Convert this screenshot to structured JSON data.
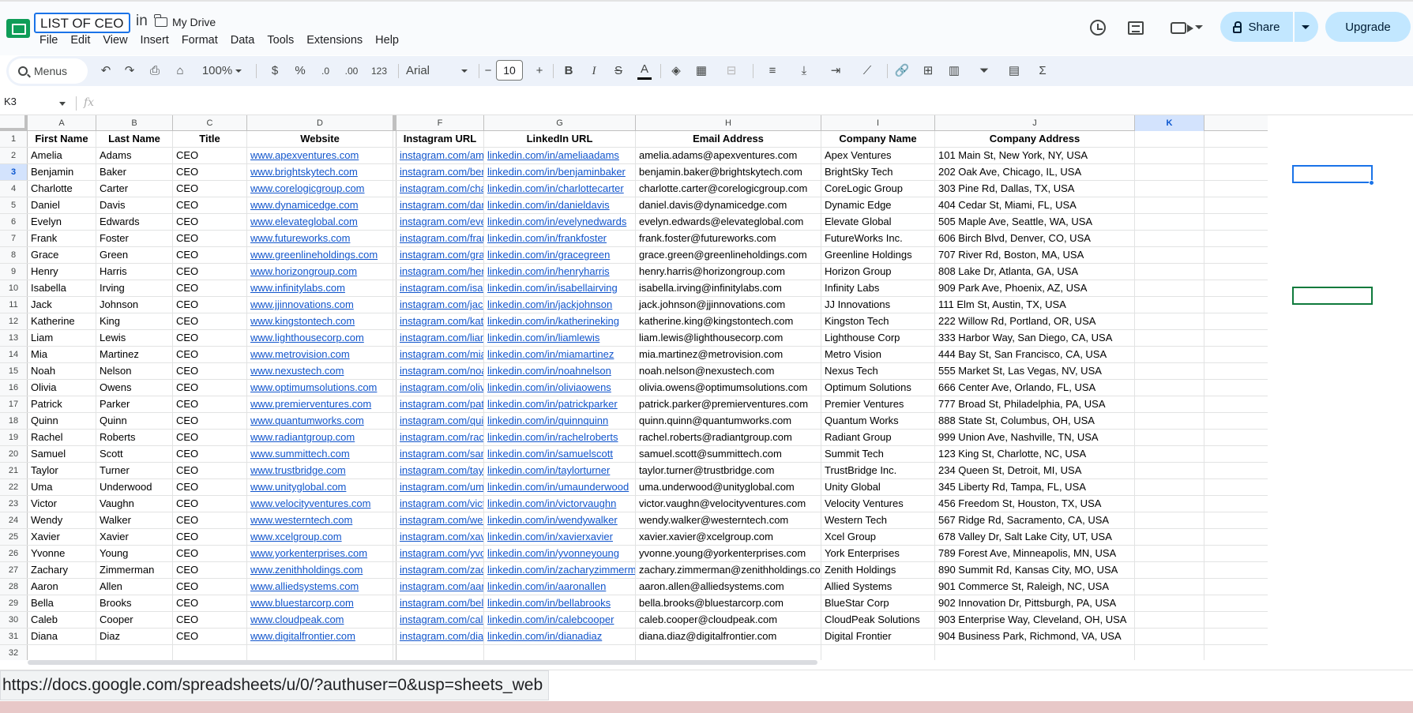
{
  "doc": {
    "title": "LIST OF CEO",
    "in_label": "in",
    "drive_label": "My Drive"
  },
  "menu": [
    "File",
    "Edit",
    "View",
    "Insert",
    "Format",
    "Data",
    "Tools",
    "Extensions",
    "Help"
  ],
  "actions": {
    "share_label": "Share",
    "upgrade_label": "Upgrade"
  },
  "toolbar": {
    "menus_label": "Menus",
    "zoom": "100%",
    "currency": "$",
    "percent": "%",
    "dec_decrease": ".0",
    "dec_increase": ".00",
    "number_format": "123",
    "font": "Arial",
    "font_size": "10",
    "minus": "−",
    "plus": "+",
    "bold": "B",
    "italic": "I",
    "strike": "S",
    "text_color": "A",
    "sigma": "Σ"
  },
  "formula_bar": {
    "cell_ref": "K3",
    "fx": "fx"
  },
  "grid": {
    "columns": [
      "A",
      "B",
      "C",
      "D",
      "F",
      "G",
      "H",
      "I",
      "J",
      "K"
    ],
    "selected_column": "K",
    "selected_row": 3,
    "header_row": [
      "First Name",
      "Last Name",
      "Title",
      "Website",
      "Instagram URL",
      "LinkedIn URL",
      "Email Address",
      "Company Name",
      "Company Address",
      ""
    ],
    "rows": [
      [
        "Amelia",
        "Adams",
        "CEO",
        "www.apexventures.com",
        "instagram.com/ameliaadams",
        "linkedin.com/in/ameliaadams",
        "amelia.adams@apexventures.com",
        "Apex Ventures",
        "101 Main St, New York, NY, USA",
        ""
      ],
      [
        "Benjamin",
        "Baker",
        "CEO",
        "www.brightskytech.com",
        "instagram.com/benjaminbaker",
        "linkedin.com/in/benjaminbaker",
        "benjamin.baker@brightskytech.com",
        "BrightSky Tech",
        "202 Oak Ave, Chicago, IL, USA",
        ""
      ],
      [
        "Charlotte",
        "Carter",
        "CEO",
        "www.corelogicgroup.com",
        "instagram.com/charlottecarter",
        "linkedin.com/in/charlottecarter",
        "charlotte.carter@corelogicgroup.com",
        "CoreLogic Group",
        "303 Pine Rd, Dallas, TX, USA",
        ""
      ],
      [
        "Daniel",
        "Davis",
        "CEO",
        "www.dynamicedge.com",
        "instagram.com/danieldavis",
        "linkedin.com/in/danieldavis",
        "daniel.davis@dynamicedge.com",
        "Dynamic Edge",
        "404 Cedar St, Miami, FL, USA",
        ""
      ],
      [
        "Evelyn",
        "Edwards",
        "CEO",
        "www.elevateglobal.com",
        "instagram.com/evelynedwards",
        "linkedin.com/in/evelynedwards",
        "evelyn.edwards@elevateglobal.com",
        "Elevate Global",
        "505 Maple Ave, Seattle, WA, USA",
        ""
      ],
      [
        "Frank",
        "Foster",
        "CEO",
        "www.futureworks.com",
        "instagram.com/frankfoster",
        "linkedin.com/in/frankfoster",
        "frank.foster@futureworks.com",
        "FutureWorks Inc.",
        "606 Birch Blvd, Denver, CO, USA",
        ""
      ],
      [
        "Grace",
        "Green",
        "CEO",
        "www.greenlineholdings.com",
        "instagram.com/gracegreen",
        "linkedin.com/in/gracegreen",
        "grace.green@greenlineholdings.com",
        "Greenline Holdings",
        "707 River Rd, Boston, MA, USA",
        ""
      ],
      [
        "Henry",
        "Harris",
        "CEO",
        "www.horizongroup.com",
        "instagram.com/henryharris",
        "linkedin.com/in/henryharris",
        "henry.harris@horizongroup.com",
        "Horizon Group",
        "808 Lake Dr, Atlanta, GA, USA",
        ""
      ],
      [
        "Isabella",
        "Irving",
        "CEO",
        "www.infinitylabs.com",
        "instagram.com/isabellairving",
        "linkedin.com/in/isabellairving",
        "isabella.irving@infinitylabs.com",
        "Infinity Labs",
        "909 Park Ave, Phoenix, AZ, USA",
        ""
      ],
      [
        "Jack",
        "Johnson",
        "CEO",
        "www.jjinnovations.com",
        "instagram.com/jackjohnson",
        "linkedin.com/in/jackjohnson",
        "jack.johnson@jjinnovations.com",
        "JJ Innovations",
        "111 Elm St, Austin, TX, USA",
        ""
      ],
      [
        "Katherine",
        "King",
        "CEO",
        "www.kingstontech.com",
        "instagram.com/katherineking",
        "linkedin.com/in/katherineking",
        "katherine.king@kingstontech.com",
        "Kingston Tech",
        "222 Willow Rd, Portland, OR, USA",
        ""
      ],
      [
        "Liam",
        "Lewis",
        "CEO",
        "www.lighthousecorp.com",
        "instagram.com/liamlewis",
        "linkedin.com/in/liamlewis",
        "liam.lewis@lighthousecorp.com",
        "Lighthouse Corp",
        "333 Harbor Way, San Diego, CA, USA",
        ""
      ],
      [
        "Mia",
        "Martinez",
        "CEO",
        "www.metrovision.com",
        "instagram.com/miamartinez",
        "linkedin.com/in/miamartinez",
        "mia.martinez@metrovision.com",
        "Metro Vision",
        "444 Bay St, San Francisco, CA, USA",
        ""
      ],
      [
        "Noah",
        "Nelson",
        "CEO",
        "www.nexustech.com",
        "instagram.com/noahnelson",
        "linkedin.com/in/noahnelson",
        "noah.nelson@nexustech.com",
        "Nexus Tech",
        "555 Market St, Las Vegas, NV, USA",
        ""
      ],
      [
        "Olivia",
        "Owens",
        "CEO",
        "www.optimumsolutions.com",
        "instagram.com/oliviaowens",
        "linkedin.com/in/oliviaowens",
        "olivia.owens@optimumsolutions.com",
        "Optimum Solutions",
        "666 Center Ave, Orlando, FL, USA",
        ""
      ],
      [
        "Patrick",
        "Parker",
        "CEO",
        "www.premierventures.com",
        "instagram.com/patrickparker",
        "linkedin.com/in/patrickparker",
        "patrick.parker@premierventures.com",
        "Premier Ventures",
        "777 Broad St, Philadelphia, PA, USA",
        ""
      ],
      [
        "Quinn",
        "Quinn",
        "CEO",
        "www.quantumworks.com",
        "instagram.com/quinnquinn",
        "linkedin.com/in/quinnquinn",
        "quinn.quinn@quantumworks.com",
        "Quantum Works",
        "888 State St, Columbus, OH, USA",
        ""
      ],
      [
        "Rachel",
        "Roberts",
        "CEO",
        "www.radiantgroup.com",
        "instagram.com/rachelroberts",
        "linkedin.com/in/rachelroberts",
        "rachel.roberts@radiantgroup.com",
        "Radiant Group",
        "999 Union Ave, Nashville, TN, USA",
        ""
      ],
      [
        "Samuel",
        "Scott",
        "CEO",
        "www.summittech.com",
        "instagram.com/samuelscott",
        "linkedin.com/in/samuelscott",
        "samuel.scott@summittech.com",
        "Summit Tech",
        "123 King St, Charlotte, NC, USA",
        ""
      ],
      [
        "Taylor",
        "Turner",
        "CEO",
        "www.trustbridge.com",
        "instagram.com/taylorturner",
        "linkedin.com/in/taylorturner",
        "taylor.turner@trustbridge.com",
        "TrustBridge Inc.",
        "234 Queen St, Detroit, MI, USA",
        ""
      ],
      [
        "Uma",
        "Underwood",
        "CEO",
        "www.unityglobal.com",
        "instagram.com/umaunderwood",
        "linkedin.com/in/umaunderwood",
        "uma.underwood@unityglobal.com",
        "Unity Global",
        "345 Liberty Rd, Tampa, FL, USA",
        ""
      ],
      [
        "Victor",
        "Vaughn",
        "CEO",
        "www.velocityventures.com",
        "instagram.com/victorvaughn",
        "linkedin.com/in/victorvaughn",
        "victor.vaughn@velocityventures.com",
        "Velocity Ventures",
        "456 Freedom St, Houston, TX, USA",
        ""
      ],
      [
        "Wendy",
        "Walker",
        "CEO",
        "www.westerntech.com",
        "instagram.com/wendywalker",
        "linkedin.com/in/wendywalker",
        "wendy.walker@westerntech.com",
        "Western Tech",
        "567 Ridge Rd, Sacramento, CA, USA",
        ""
      ],
      [
        "Xavier",
        "Xavier",
        "CEO",
        "www.xcelgroup.com",
        "instagram.com/xavierxavier",
        "linkedin.com/in/xavierxavier",
        "xavier.xavier@xcelgroup.com",
        "Xcel Group",
        "678 Valley Dr, Salt Lake City, UT, USA",
        ""
      ],
      [
        "Yvonne",
        "Young",
        "CEO",
        "www.yorkenterprises.com",
        "instagram.com/yvonneyoung",
        "linkedin.com/in/yvonneyoung",
        "yvonne.young@yorkenterprises.com",
        "York Enterprises",
        "789 Forest Ave, Minneapolis, MN, USA",
        ""
      ],
      [
        "Zachary",
        "Zimmerman",
        "CEO",
        "www.zenithholdings.com",
        "instagram.com/zacharyzimmerman",
        "linkedin.com/in/zacharyzimmerman",
        "zachary.zimmerman@zenithholdings.com",
        "Zenith Holdings",
        "890 Summit Rd, Kansas City, MO, USA",
        ""
      ],
      [
        "Aaron",
        "Allen",
        "CEO",
        "www.alliedsystems.com",
        "instagram.com/aaronallen",
        "linkedin.com/in/aaronallen",
        "aaron.allen@alliedsystems.com",
        "Allied Systems",
        "901 Commerce St, Raleigh, NC, USA",
        ""
      ],
      [
        "Bella",
        "Brooks",
        "CEO",
        "www.bluestarcorp.com",
        "instagram.com/bellabrooks",
        "linkedin.com/in/bellabrooks",
        "bella.brooks@bluestarcorp.com",
        "BlueStar Corp",
        "902 Innovation Dr, Pittsburgh, PA, USA",
        ""
      ],
      [
        "Caleb",
        "Cooper",
        "CEO",
        "www.cloudpeak.com",
        "instagram.com/calebcooper",
        "linkedin.com/in/calebcooper",
        "caleb.cooper@cloudpeak.com",
        "CloudPeak Solutions",
        "903 Enterprise Way, Cleveland, OH, USA",
        ""
      ],
      [
        "Diana",
        "Diaz",
        "CEO",
        "www.digitalfrontier.com",
        "instagram.com/dianadiaz",
        "linkedin.com/in/dianadiaz",
        "diana.diaz@digitalfrontier.com",
        "Digital Frontier",
        "904 Business Park, Richmond, VA, USA",
        ""
      ]
    ]
  },
  "status": {
    "url_tooltip": "https://docs.google.com/spreadsheets/u/0/?authuser=0&usp=sheets_web"
  },
  "colors": {
    "accent": "#1a73e8",
    "link": "#1155cc",
    "share_bg": "#c2e7ff",
    "toolbar_bg": "#edf2fa"
  }
}
